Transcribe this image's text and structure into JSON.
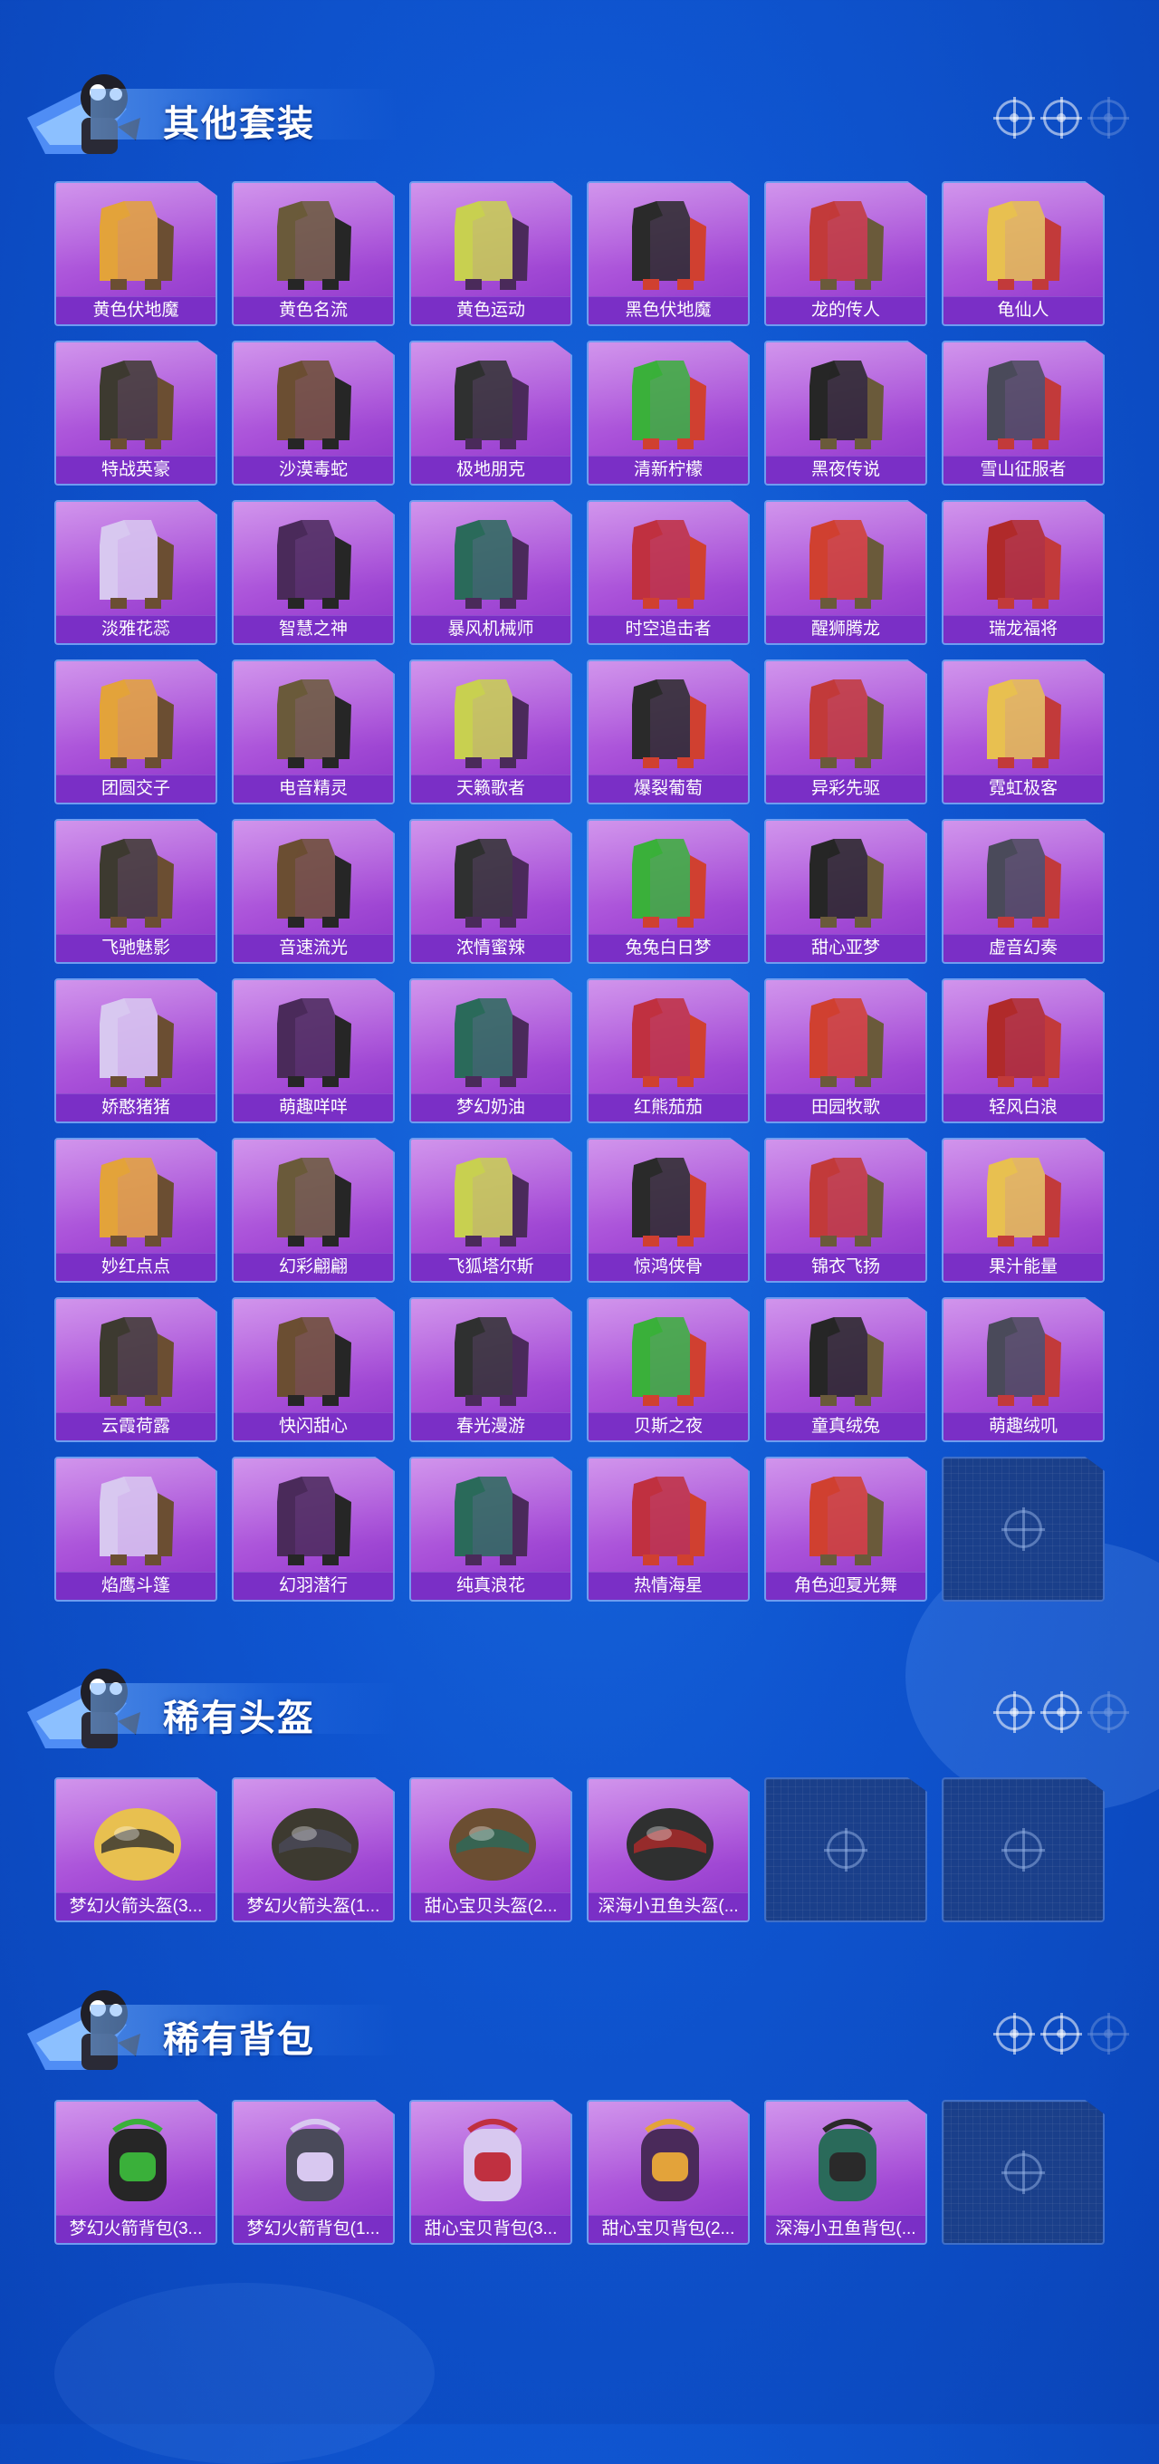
{
  "colors": {
    "background": "#0f55d0",
    "tile": "#a84fd8",
    "label_bar": "#7a2fc6",
    "empty_tile": "#1a3f8a"
  },
  "sections": [
    {
      "title": "其他套装",
      "items": [
        "黄色伏地魔",
        "黄色名流",
        "黄色运动",
        "黑色伏地魔",
        "龙的传人",
        "龟仙人",
        "特战英豪",
        "沙漠毒蛇",
        "极地朋克",
        "清新柠檬",
        "黑夜传说",
        "雪山征服者",
        "淡雅花蕊",
        "智慧之神",
        "暴风机械师",
        "时空追击者",
        "醒狮腾龙",
        "瑞龙福将",
        "团圆交子",
        "电音精灵",
        "天籁歌者",
        "爆裂葡萄",
        "异彩先驱",
        "霓虹极客",
        "飞驰魅影",
        "音速流光",
        "浓情蜜辣",
        "兔兔白日梦",
        "甜心亚梦",
        "虚音幻奏",
        "娇憨猪猪",
        "萌趣咩咩",
        "梦幻奶油",
        "红熊茄茄",
        "田园牧歌",
        "轻风白浪",
        "妙红点点",
        "幻彩翩翩",
        "飞狐塔尔斯",
        "惊鸿侠骨",
        "锦衣飞扬",
        "果汁能量",
        "云霞荷露",
        "快闪甜心",
        "春光漫游",
        "贝斯之夜",
        "童真绒兔",
        "萌趣绒叽",
        "焰鹰斗篷",
        "幻羽潜行",
        "纯真浪花",
        "热情海星",
        "角色迎夏光舞"
      ],
      "empty_slots": 1
    },
    {
      "title": "稀有头盔",
      "items": [
        "梦幻火箭头盔(3...",
        "梦幻火箭头盔(1...",
        "甜心宝贝头盔(2...",
        "深海小丑鱼头盔(..."
      ],
      "empty_slots": 2
    },
    {
      "title": "稀有背包",
      "items": [
        "梦幻火箭背包(3...",
        "梦幻火箭背包(1...",
        "甜心宝贝背包(3...",
        "甜心宝贝背包(2...",
        "深海小丑鱼背包(..."
      ],
      "empty_slots": 1
    }
  ]
}
